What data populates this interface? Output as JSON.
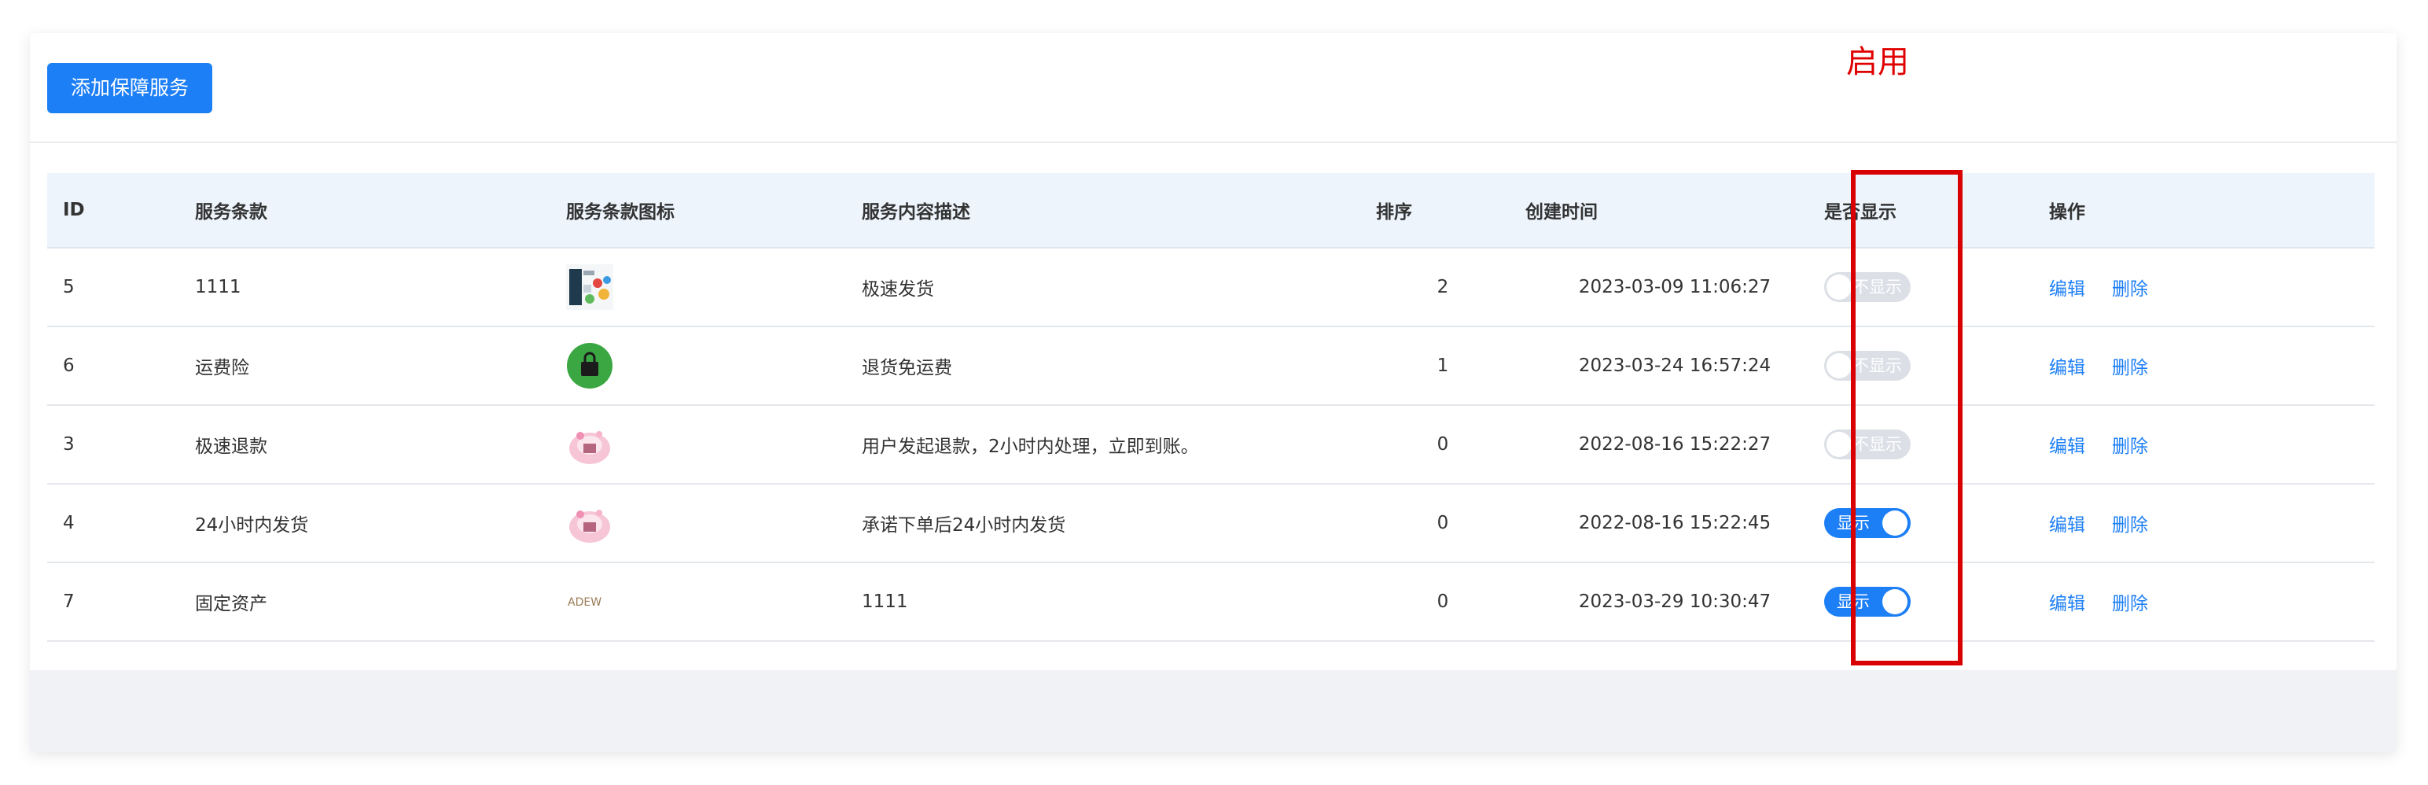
{
  "toolbar": {
    "add_button_label": "添加保障服务"
  },
  "annotation": {
    "label": "启用",
    "color": "#e00000"
  },
  "table": {
    "headers": {
      "id": "ID",
      "name": "服务条款",
      "icon": "服务条款图标",
      "desc": "服务内容描述",
      "sort": "排序",
      "created": "创建时间",
      "show": "是否显示",
      "actions": "操作"
    },
    "rows": [
      {
        "id": "5",
        "name": "1111",
        "icon": "product-collage-icon",
        "desc": "极速发货",
        "sort": "2",
        "created": "2023-03-09 11:06:27",
        "show": false,
        "show_label": "不显示"
      },
      {
        "id": "6",
        "name": "运费险",
        "icon": "shopping-bag-icon",
        "desc": "退货免运费",
        "sort": "1",
        "created": "2023-03-24 16:57:24",
        "show": false,
        "show_label": "不显示"
      },
      {
        "id": "3",
        "name": "极速退款",
        "icon": "pink-gift-icon",
        "desc": "用户发起退款，2小时内处理，立即到账。",
        "sort": "0",
        "created": "2022-08-16 15:22:27",
        "show": false,
        "show_label": "不显示"
      },
      {
        "id": "4",
        "name": "24小时内发货",
        "icon": "pink-gift-icon",
        "desc": "承诺下单后24小时内发货",
        "sort": "0",
        "created": "2022-08-16 15:22:45",
        "show": true,
        "show_label": "显示"
      },
      {
        "id": "7",
        "name": "固定资产",
        "icon": "brand-logo-icon",
        "desc": "1111",
        "sort": "0",
        "created": "2023-03-29 10:30:47",
        "show": true,
        "show_label": "显示"
      }
    ],
    "edit_label": "编辑",
    "delete_label": "删除"
  },
  "colors": {
    "primary": "#1d7ff5",
    "header_bg": "#edf4fc",
    "annotation_box": "#d80000"
  }
}
